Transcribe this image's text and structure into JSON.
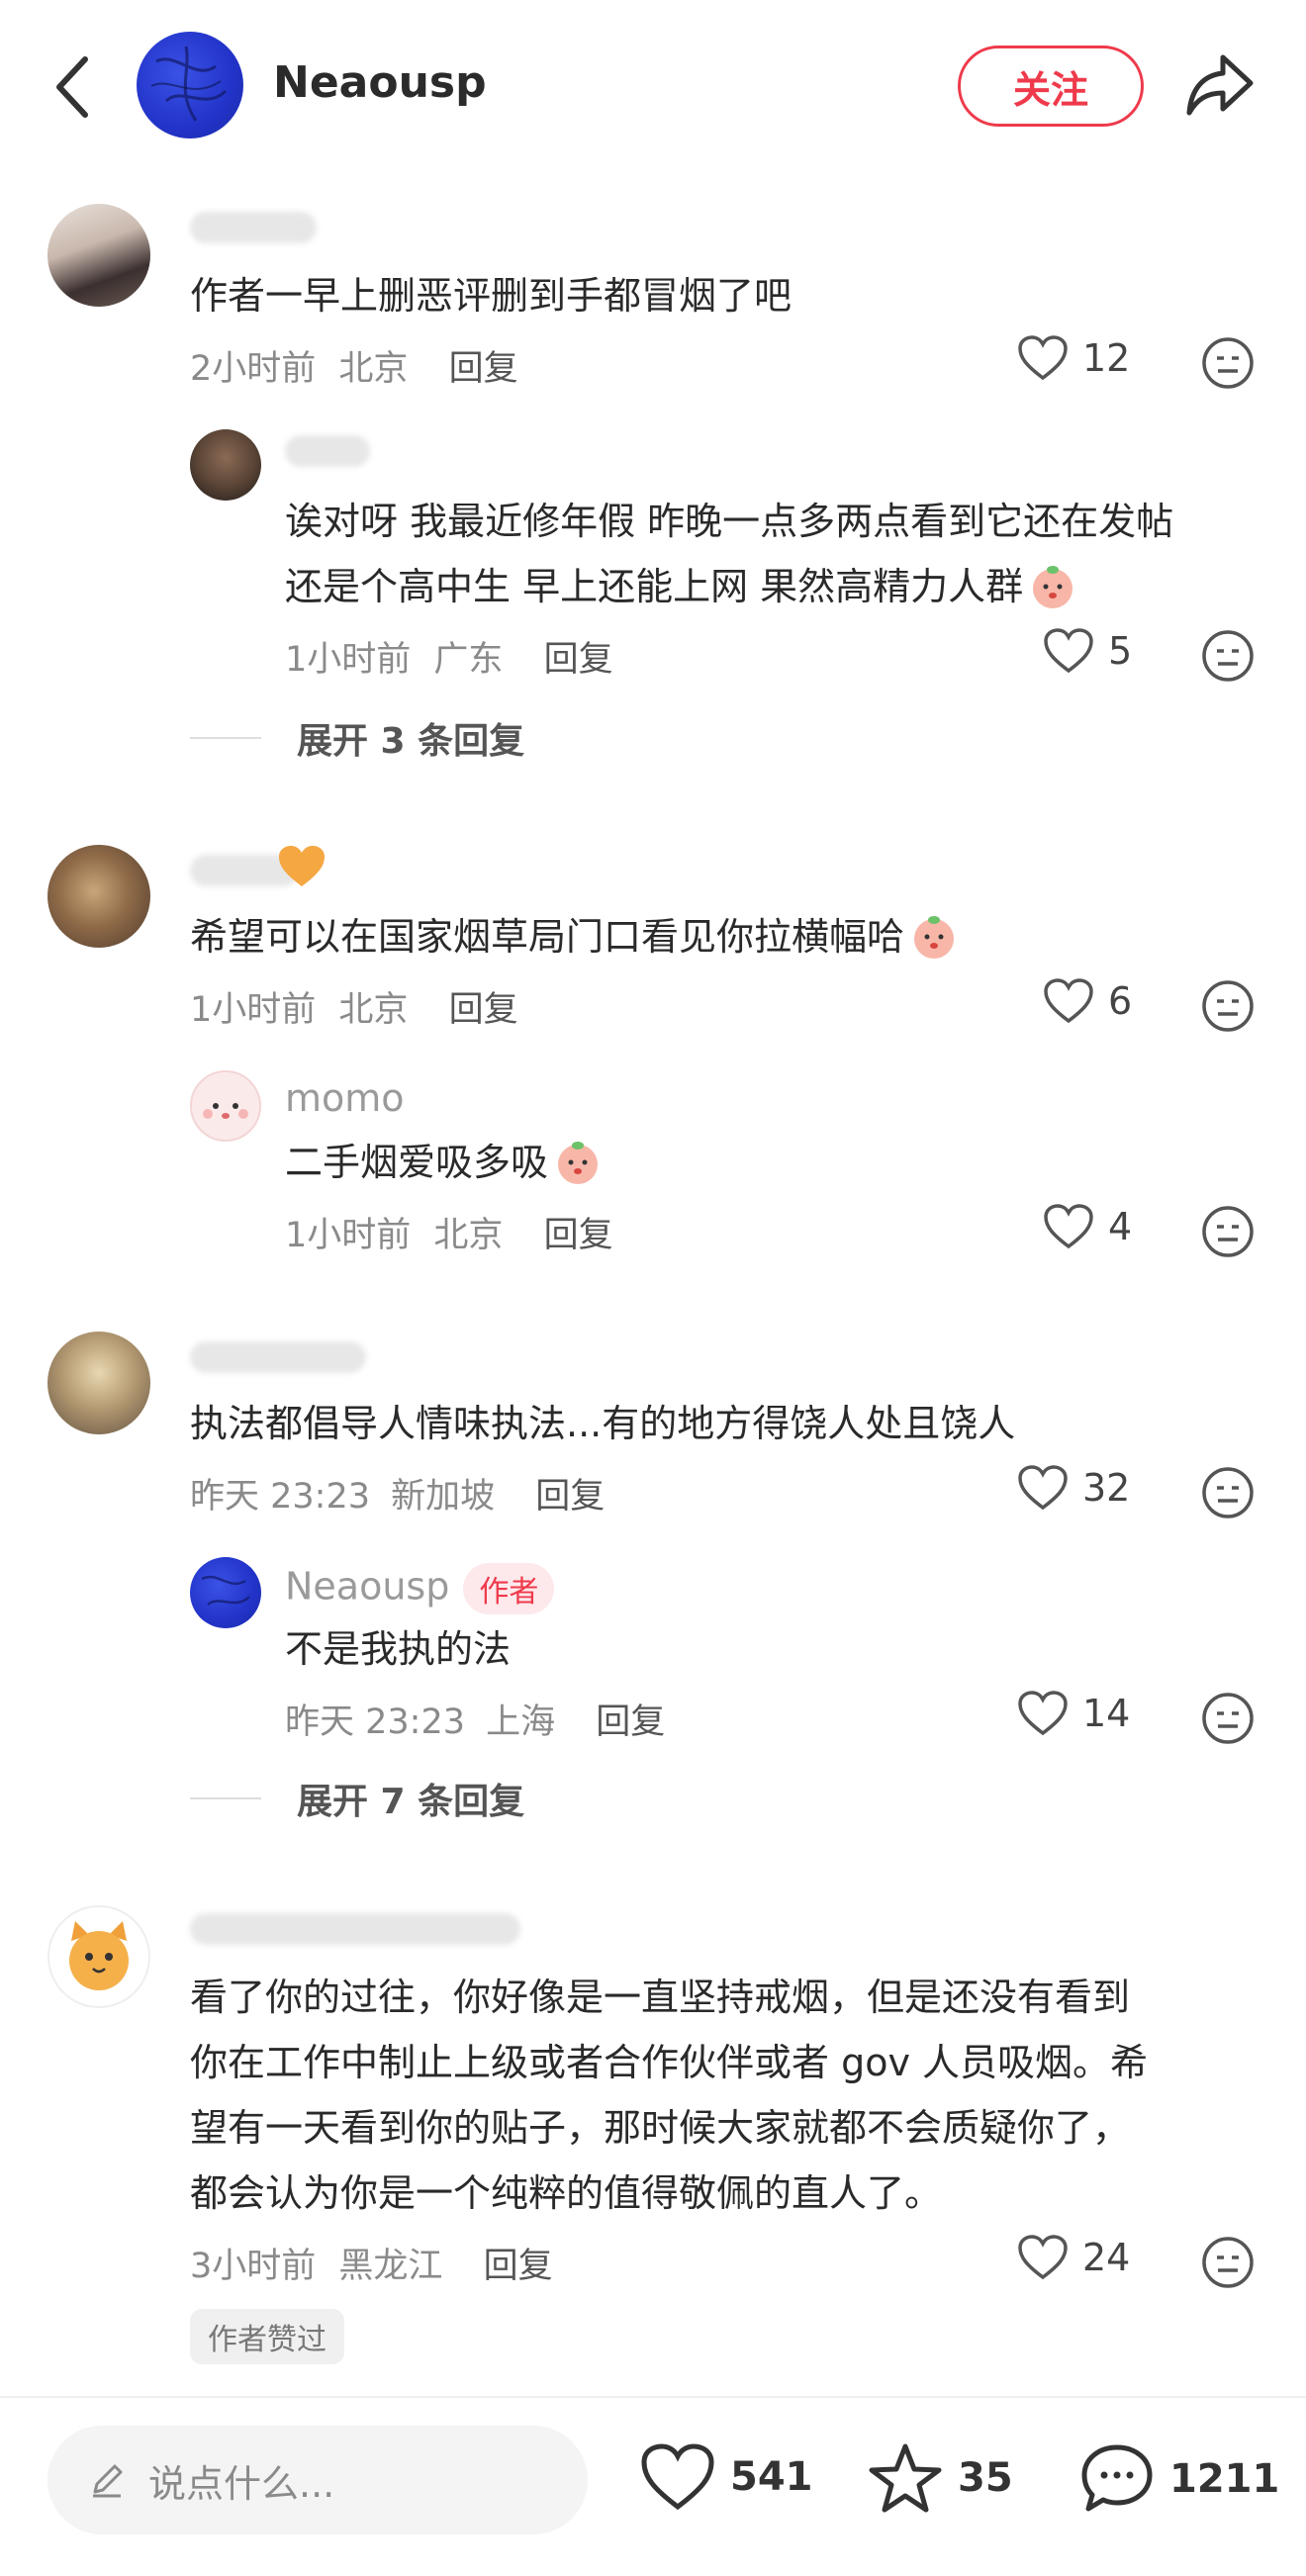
{
  "header": {
    "username": "Neaousp",
    "follow_label": "关注"
  },
  "comments": [
    {
      "text": "作者一早上删恶评删到手都冒烟了吧",
      "time": "2小时前",
      "location": "北京",
      "reply_label": "回复",
      "likes": "12",
      "replies": [
        {
          "text_line1": "诶对呀 我最近修年假 昨晚一点多两点看到它还在发帖",
          "text_line2": "还是个高中生 早上还能上网 果然高精力人群",
          "time": "1小时前",
          "location": "广东",
          "reply_label": "回复",
          "likes": "5"
        }
      ],
      "expand_label": "展开 3 条回复"
    },
    {
      "text": "希望可以在国家烟草局门口看见你拉横幅哈",
      "time": "1小时前",
      "location": "北京",
      "reply_label": "回复",
      "likes": "6",
      "replies": [
        {
          "username": "momo",
          "text": "二手烟爱吸多吸",
          "time": "1小时前",
          "location": "北京",
          "reply_label": "回复",
          "likes": "4"
        }
      ]
    },
    {
      "text": "执法都倡导人情味执法...有的地方得饶人处且饶人",
      "time": "昨天 23:23",
      "location": "新加坡",
      "reply_label": "回复",
      "likes": "32",
      "replies": [
        {
          "username": "Neaousp",
          "author_tag": "作者",
          "text": "不是我执的法",
          "time": "昨天 23:23",
          "location": "上海",
          "reply_label": "回复",
          "likes": "14"
        }
      ],
      "expand_label": "展开 7 条回复"
    },
    {
      "text_lines": [
        "看了你的过往，你好像是一直坚持戒烟，但是还没有看到",
        "你在工作中制止上级或者合作伙伴或者 gov 人员吸烟。希",
        "望有一天看到你的贴子，那时候大家就都不会质疑你了，",
        "都会认为你是一个纯粹的值得敬佩的直人了。"
      ],
      "time": "3小时前",
      "location": "黑龙江",
      "reply_label": "回复",
      "likes": "24",
      "liked_by_author_tag": "作者赞过"
    }
  ],
  "bottom_bar": {
    "input_placeholder": "说点什么...",
    "likes": "541",
    "stars": "35",
    "comments": "1211"
  },
  "colors": {
    "accent": "#ee3a4b",
    "avatar_blue": "#2a3dd6"
  }
}
